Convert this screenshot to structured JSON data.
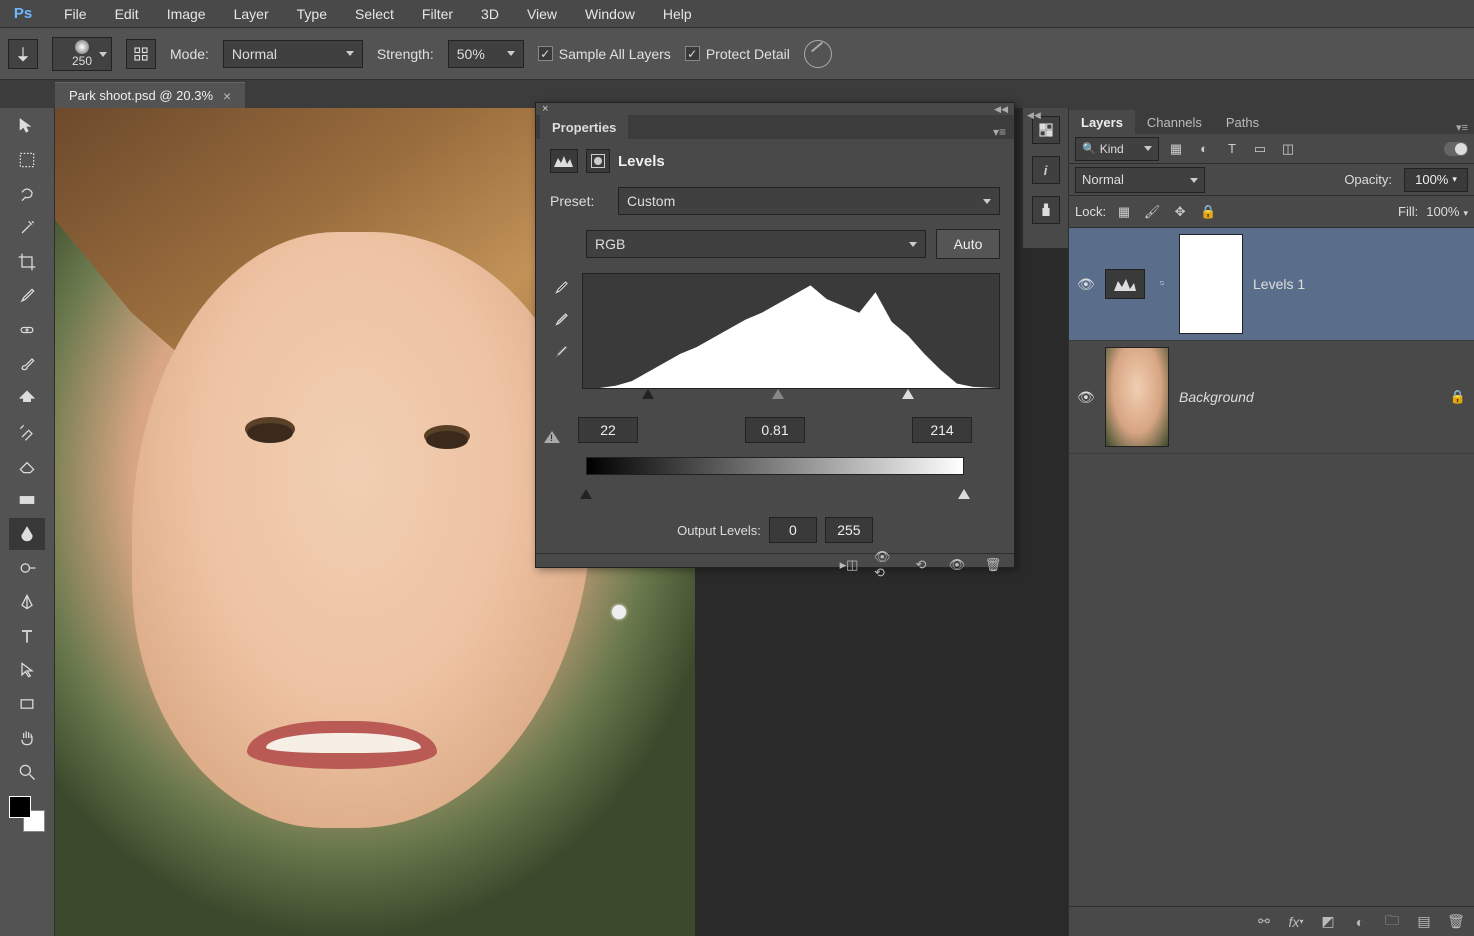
{
  "menu": {
    "items": [
      "File",
      "Edit",
      "Image",
      "Layer",
      "Type",
      "Select",
      "Filter",
      "3D",
      "View",
      "Window",
      "Help"
    ]
  },
  "optionbar": {
    "brush_size": "250",
    "mode_label": "Mode:",
    "mode_value": "Normal",
    "strength_label": "Strength:",
    "strength_value": "50%",
    "sample_all_label": "Sample All Layers",
    "sample_all_checked": true,
    "protect_detail_label": "Protect Detail",
    "protect_detail_checked": true
  },
  "document": {
    "tab_title": "Park shoot.psd @ 20.3%"
  },
  "properties": {
    "panel_tab": "Properties",
    "title": "Levels",
    "preset_label": "Preset:",
    "preset_value": "Custom",
    "channel_value": "RGB",
    "auto_btn": "Auto",
    "input_black": "22",
    "input_gamma": "0.81",
    "input_white": "214",
    "output_label": "Output Levels:",
    "output_black": "0",
    "output_white": "255"
  },
  "layers_panel": {
    "tabs": {
      "layers": "Layers",
      "channels": "Channels",
      "paths": "Paths"
    },
    "filter_kind": "Kind",
    "blend_mode": "Normal",
    "opacity_label": "Opacity:",
    "opacity_value": "100%",
    "lock_label": "Lock:",
    "fill_label": "Fill:",
    "fill_value": "100%",
    "layer1_name": "Levels 1",
    "layer2_name": "Background"
  },
  "chart_data": {
    "type": "area",
    "title": "Levels",
    "xlabel": "",
    "ylabel": "",
    "xlim": [
      0,
      255
    ],
    "ylim": [
      0,
      100
    ],
    "series": [
      {
        "name": "histogram",
        "x": [
          0,
          10,
          20,
          30,
          40,
          50,
          60,
          70,
          80,
          90,
          100,
          110,
          120,
          130,
          140,
          150,
          160,
          170,
          180,
          190,
          200,
          210,
          220,
          230,
          240,
          255
        ],
        "values": [
          0,
          0,
          2,
          6,
          14,
          22,
          30,
          36,
          44,
          52,
          60,
          66,
          74,
          82,
          90,
          78,
          72,
          66,
          84,
          58,
          46,
          30,
          16,
          4,
          1,
          0
        ]
      }
    ],
    "input_sliders": {
      "black": 22,
      "gamma": 0.81,
      "white": 214
    },
    "output_sliders": {
      "black": 0,
      "white": 255
    }
  }
}
